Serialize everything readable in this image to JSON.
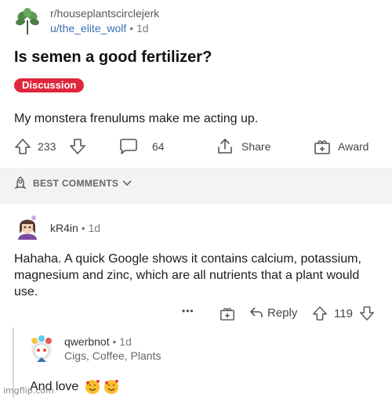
{
  "post": {
    "subreddit": "r/houseplantscirclejerk",
    "username": "u/the_elite_wolf",
    "separator": "•",
    "age": "1d",
    "title": "Is semen a good fertilizer?",
    "flair": "Discussion",
    "body": "My monstera frenulums make me acting up.",
    "upvotes": "233",
    "comments": "64",
    "share_label": "Share",
    "award_label": "Award"
  },
  "sort": {
    "label": "BEST COMMENTS"
  },
  "comment": {
    "username": "kR4in",
    "separator": "•",
    "age": "1d",
    "body": "Hahaha. A quick Google shows it contains calcium, potassium, magnesium and zinc, which are all nutrients that a plant would use.",
    "more": "•••",
    "reply_label": "Reply",
    "votes": "119"
  },
  "reply": {
    "username": "qwerbnot",
    "separator": "•",
    "age": "1d",
    "user_flair": "Cigs, Coffee, Plants",
    "body": "And love"
  },
  "watermark": "imgflip.com",
  "colors": {
    "flair_bg": "#e0263c",
    "link_blue": "#3a6fb0",
    "band": "#f2f3f5"
  }
}
